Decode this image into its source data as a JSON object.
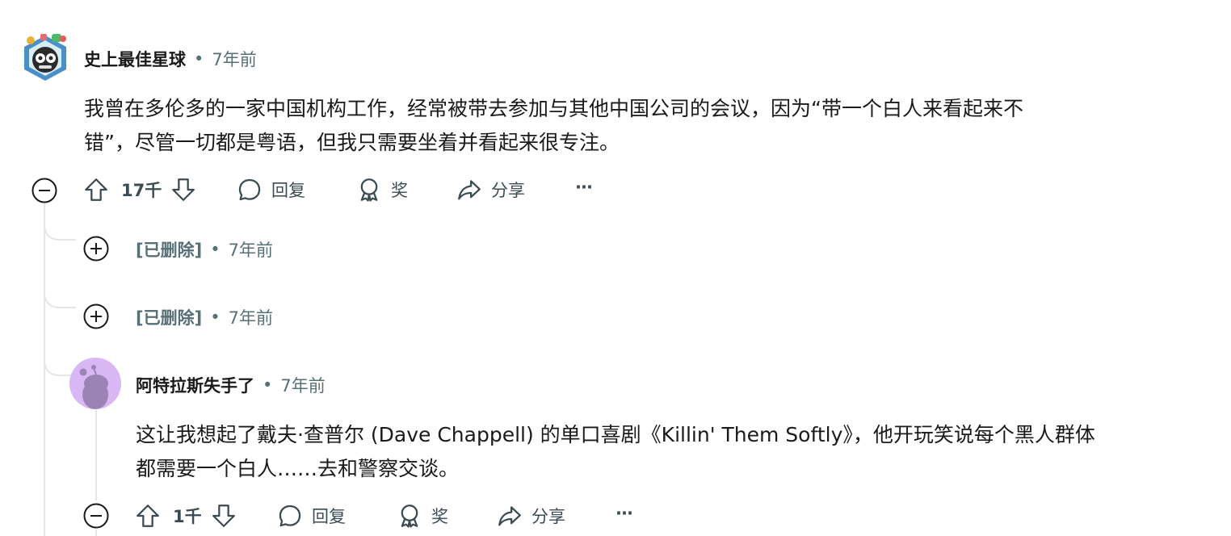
{
  "colors": {
    "text": "#1a1a1b",
    "meta": "#576f76",
    "action": "#3c4b52",
    "rail": "#e3e6e8",
    "avatar_purple": "#d9b7f5",
    "snoo": "#9b83b5"
  },
  "comments": [
    {
      "author": "史上最佳星球",
      "separator": "•",
      "time": "7年前",
      "text_line1": "我曾在多伦多的一家中国机构工作，经常被带去参加与其他中国公司的会议，因为“带一个白人来看起来不",
      "text_line2": "错”，尽管一切都是粤语，但我只需要坐着并看起来很专注。",
      "score": "17千",
      "reply_label": "回复",
      "award_label": "奖",
      "share_label": "分享",
      "more_label": "···",
      "collapse_icon": "collapse-minus-icon",
      "avatar_icon": "avatar-robot-icon"
    },
    {
      "author": "[已删除]",
      "separator": "•",
      "time": "7年前",
      "expand_icon": "expand-plus-icon"
    },
    {
      "author": "[已删除]",
      "separator": "•",
      "time": "7年前",
      "expand_icon": "expand-plus-icon"
    },
    {
      "author": "阿特拉斯失手了",
      "separator": "•",
      "time": "7年前",
      "text_line1": "这让我想起了戴夫·查普尔 (Dave Chappell) 的单口喜剧《Killin' Them Softly》，他开玩笑说每个黑人群体",
      "text_line2": "都需要一个白人……去和警察交谈。",
      "score": "1千",
      "reply_label": "回复",
      "award_label": "奖",
      "share_label": "分享",
      "more_label": "···",
      "collapse_icon": "collapse-minus-icon",
      "avatar_icon": "snoo-avatar-icon"
    }
  ]
}
